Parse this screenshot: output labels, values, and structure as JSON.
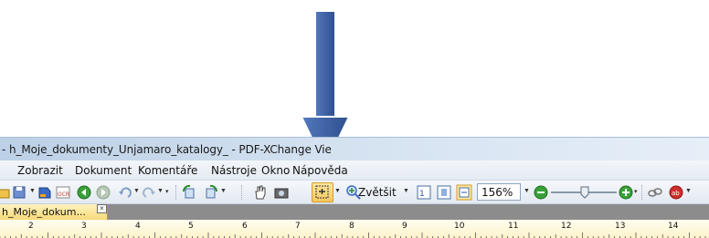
{
  "window": {
    "title": "- h_Moje_dokumenty_Unjamaro_katalogy_ - PDF-XChange Vie"
  },
  "menu": {
    "items": [
      "Zobrazit",
      "Dokument",
      "Komentáře",
      "Nástroje",
      "Okno",
      "Nápověda"
    ]
  },
  "toolbar": {
    "zoom_in_label": "Zvětšit",
    "zoom_value": "156%",
    "active_tool": "marquee-zoom-tool"
  },
  "tabs": {
    "active_label": "h_Moje_dokum...",
    "close_glyph": "×"
  },
  "ruler": {
    "numbers": [
      "2",
      "3",
      "4",
      "5",
      "6",
      "7",
      "8",
      "9",
      "10",
      "11",
      "12",
      "13",
      "14"
    ]
  },
  "colors": {
    "arrow": "#3c5c9c",
    "active_tab": "#f7d977",
    "ruler": "#fdf3c9"
  }
}
